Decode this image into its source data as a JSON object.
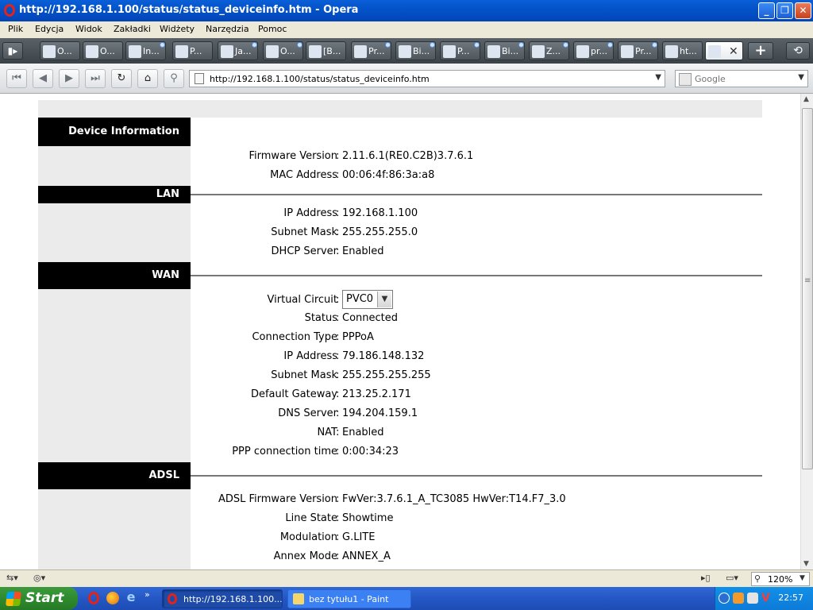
{
  "window": {
    "title": "http://192.168.1.100/status/status_deviceinfo.htm - Opera",
    "buttons": {
      "minimize": "_",
      "maximize": "❐",
      "close": "✕"
    }
  },
  "menu": [
    "Plik",
    "Edycja",
    "Widok",
    "Zakładki",
    "Widżety",
    "Narzędzia",
    "Pomoc"
  ],
  "tabs": [
    {
      "label": "O...",
      "icon": "ie-icon"
    },
    {
      "label": "O...",
      "icon": "page-icon"
    },
    {
      "label": "In...",
      "icon": "page-icon"
    },
    {
      "label": "P...",
      "icon": "page-icon"
    },
    {
      "label": "Ja...",
      "icon": "page-icon"
    },
    {
      "label": "O...",
      "icon": "page-icon"
    },
    {
      "label": "[B...",
      "icon": "page-icon"
    },
    {
      "label": "Pr...",
      "icon": "page-icon"
    },
    {
      "label": "Bi...",
      "icon": "page-icon"
    },
    {
      "label": "P...",
      "icon": "page-icon"
    },
    {
      "label": "Bi...",
      "icon": "page-icon"
    },
    {
      "label": "Z...",
      "icon": "page-icon"
    },
    {
      "label": "pr...",
      "icon": "page-icon"
    },
    {
      "label": "Pr...",
      "icon": "page-icon"
    },
    {
      "label": "ht...",
      "icon": "page-icon"
    }
  ],
  "active_tab": {
    "close": "✕"
  },
  "toolbar": {
    "address": "http://192.168.1.100/status/status_deviceinfo.htm",
    "search_placeholder": "Google"
  },
  "page": {
    "device": {
      "heading": "Device Information",
      "rows": [
        {
          "label": "Firmware Version",
          "value": "2.11.6.1(RE0.C2B)3.7.6.1"
        },
        {
          "label": "MAC Address",
          "value": "00:06:4f:86:3a:a8"
        }
      ]
    },
    "lan": {
      "heading": "LAN",
      "rows": [
        {
          "label": "IP Address",
          "value": "192.168.1.100"
        },
        {
          "label": "Subnet Mask",
          "value": "255.255.255.0"
        },
        {
          "label": "DHCP Server",
          "value": "Enabled"
        }
      ]
    },
    "wan": {
      "heading": "WAN",
      "virtual_circuit": {
        "label": "Virtual Circuit",
        "value": "PVC0"
      },
      "rows": [
        {
          "label": "Status",
          "value": "Connected"
        },
        {
          "label": "Connection Type",
          "value": "PPPoA"
        },
        {
          "label": "IP Address",
          "value": "79.186.148.132"
        },
        {
          "label": "Subnet Mask",
          "value": "255.255.255.255"
        },
        {
          "label": "Default Gateway",
          "value": "213.25.2.171"
        },
        {
          "label": "DNS Server",
          "value": "194.204.159.1"
        },
        {
          "label": "NAT",
          "value": "Enabled"
        },
        {
          "label": "PPP connection time",
          "value": "0:00:34:23"
        }
      ]
    },
    "adsl": {
      "heading": "ADSL",
      "rows": [
        {
          "label": "ADSL Firmware Version",
          "value": "FwVer:3.7.6.1_A_TC3085 HwVer:T14.F7_3.0"
        },
        {
          "label": "Line State",
          "value": "Showtime"
        },
        {
          "label": "Modulation",
          "value": "G.LITE"
        },
        {
          "label": "Annex Mode",
          "value": "ANNEX_A"
        }
      ]
    },
    "colon": ":"
  },
  "statusbar": {
    "zoom": "120%"
  },
  "taskbar": {
    "start": "Start",
    "tasks": [
      {
        "label": "http://192.168.1.100...",
        "state": "active"
      },
      {
        "label": "bez tytułu1 - Paint",
        "state": "inactive"
      }
    ],
    "clock": "22:57"
  }
}
